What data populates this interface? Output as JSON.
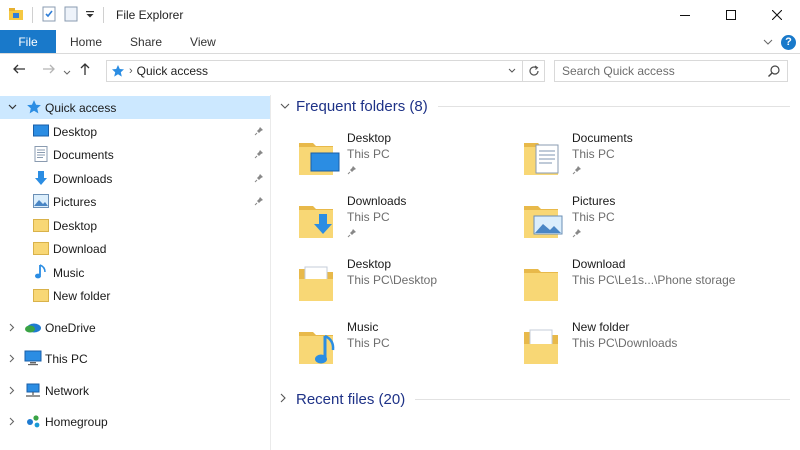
{
  "window": {
    "title": "File Explorer"
  },
  "ribbon": {
    "tabs": [
      {
        "label": "File"
      },
      {
        "label": "Home"
      },
      {
        "label": "Share"
      },
      {
        "label": "View"
      }
    ],
    "help_label": "?"
  },
  "address": {
    "breadcrumb": "Quick access"
  },
  "search": {
    "placeholder": "Search Quick access"
  },
  "nav": {
    "quick_access": {
      "label": "Quick access",
      "icon": "star-icon"
    },
    "quick_items": [
      {
        "label": "Desktop",
        "icon": "desktop-icon",
        "pinned": true
      },
      {
        "label": "Documents",
        "icon": "documents-icon",
        "pinned": true
      },
      {
        "label": "Downloads",
        "icon": "downloads-icon",
        "pinned": true
      },
      {
        "label": "Pictures",
        "icon": "pictures-icon",
        "pinned": true
      },
      {
        "label": "Desktop",
        "icon": "folder-icon",
        "pinned": false
      },
      {
        "label": "Download",
        "icon": "folder-icon",
        "pinned": false
      },
      {
        "label": "Music",
        "icon": "music-icon",
        "pinned": false
      },
      {
        "label": "New folder",
        "icon": "folder-icon",
        "pinned": false
      }
    ],
    "roots": [
      {
        "label": "OneDrive",
        "icon": "onedrive-icon"
      },
      {
        "label": "This PC",
        "icon": "this-pc-icon"
      },
      {
        "label": "Network",
        "icon": "network-icon"
      },
      {
        "label": "Homegroup",
        "icon": "homegroup-icon"
      }
    ]
  },
  "content": {
    "frequent_header": "Frequent folders (8)",
    "recent_header": "Recent files (20)",
    "folders": [
      {
        "name": "Desktop",
        "path": "This PC",
        "pinned": true,
        "icon": "desktop-folder-icon"
      },
      {
        "name": "Documents",
        "path": "This PC",
        "pinned": true,
        "icon": "documents-folder-icon"
      },
      {
        "name": "Downloads",
        "path": "This PC",
        "pinned": true,
        "icon": "downloads-folder-icon"
      },
      {
        "name": "Pictures",
        "path": "This PC",
        "pinned": true,
        "icon": "pictures-folder-icon"
      },
      {
        "name": "Desktop",
        "path": "This PC\\Desktop",
        "pinned": false,
        "icon": "folder-icon"
      },
      {
        "name": "Download",
        "path": "This PC\\Le1s...\\Phone storage",
        "pinned": false,
        "icon": "folder-icon"
      },
      {
        "name": "Music",
        "path": "This PC",
        "pinned": false,
        "icon": "music-folder-icon"
      },
      {
        "name": "New folder",
        "path": "This PC\\Downloads",
        "pinned": false,
        "icon": "folder-icon"
      }
    ]
  },
  "colors": {
    "accent": "#1979ca",
    "selection": "#cce8ff",
    "group_header": "#1e3287",
    "folder_yellow": "#f8d775"
  }
}
